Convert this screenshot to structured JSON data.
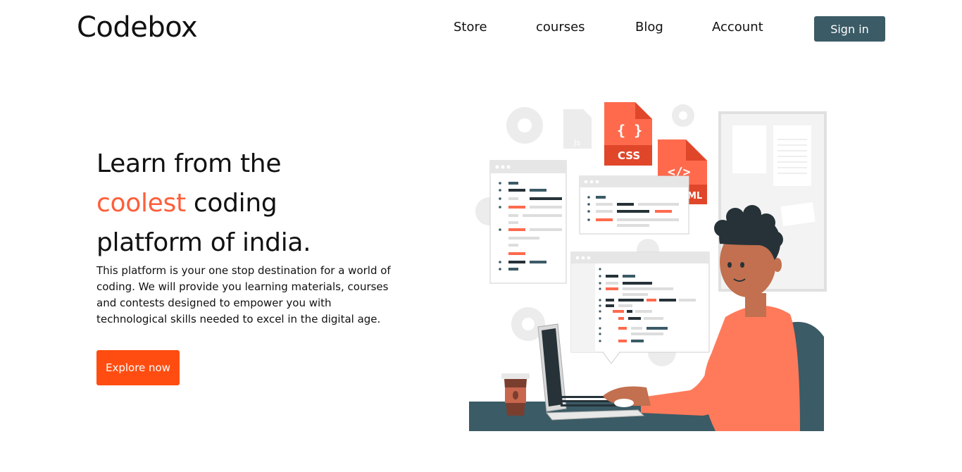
{
  "brand": {
    "logo_text": "Codebox"
  },
  "nav": {
    "items": [
      {
        "label": "Store"
      },
      {
        "label": "courses"
      },
      {
        "label": "Blog"
      },
      {
        "label": "Account"
      }
    ],
    "signin_label": "Sign in"
  },
  "hero": {
    "title_line1": "Learn from the",
    "title_accent": "coolest",
    "title_line2_rest": " coding",
    "title_line3": "platform of india.",
    "description": "This platform is your one stop destination for a world of coding. We will provide you learning materials, courses and contests designed to empower you with technological skills needed to excel in the digital age.",
    "cta_label": "Explore now"
  },
  "illustration": {
    "css_label": "CSS",
    "css_symbol": "{ }",
    "html_symbol": "</>",
    "html_label": "ML",
    "js_label": "Js"
  },
  "colors": {
    "accent": "#ff5e3a",
    "cta": "#ff4d11",
    "signin": "#3b5b66",
    "person_shirt": "#ff7a5a",
    "desk": "#3b5b66"
  }
}
